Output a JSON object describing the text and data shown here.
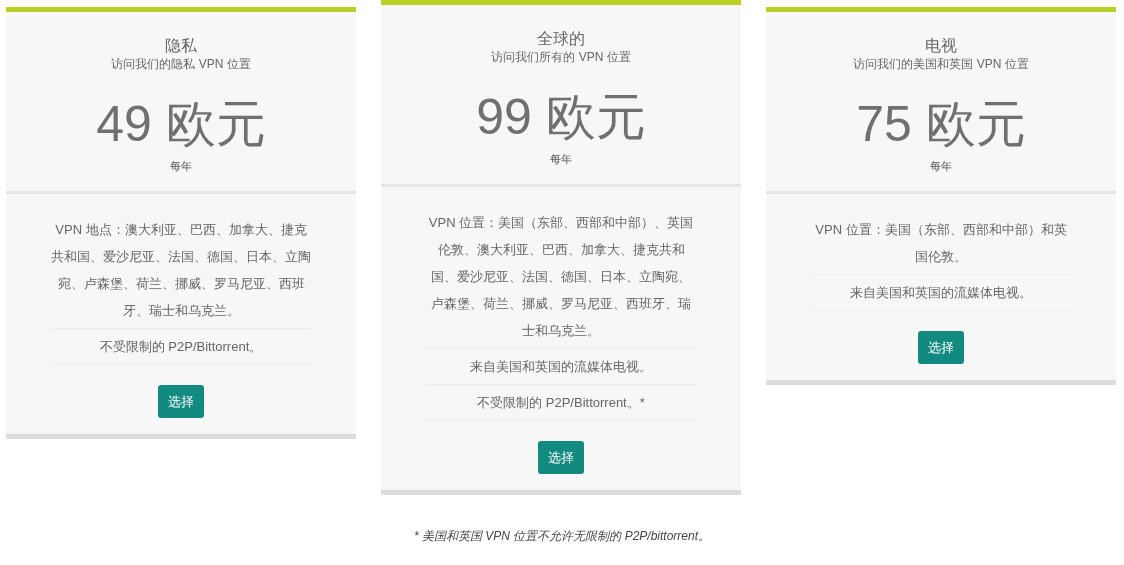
{
  "plans": [
    {
      "title": "隐私",
      "subtitle": "访问我们的隐私 VPN 位置",
      "price": "49 欧元",
      "period": "每年",
      "featured": false,
      "features": [
        "VPN 地点：澳大利亚、巴西、加拿大、捷克共和国、爱沙尼亚、法国、德国、日本、立陶宛、卢森堡、荷兰、挪威、罗马尼亚、西班牙、瑞士和乌克兰。",
        "不受限制的 P2P/Bittorrent。"
      ],
      "button": "选择"
    },
    {
      "title": "全球的",
      "subtitle": "访问我们所有的 VPN 位置",
      "price": "99 欧元",
      "period": "每年",
      "featured": true,
      "features": [
        "VPN 位置：美国（东部、西部和中部）、英国伦敦、澳大利亚、巴西、加拿大、捷克共和国、爱沙尼亚、法国、德国、日本、立陶宛、卢森堡、荷兰、挪威、罗马尼亚、西班牙、瑞士和乌克兰。",
        "来自美国和英国的流媒体电视。",
        "不受限制的 P2P/Bittorrent。*"
      ],
      "button": "选择"
    },
    {
      "title": "电视",
      "subtitle": "访问我们的美国和英国 VPN 位置",
      "price": "75 欧元",
      "period": "每年",
      "featured": false,
      "features": [
        "VPN 位置：美国（东部、西部和中部）和英国伦敦。",
        "来自美国和英国的流媒体电视。"
      ],
      "button": "选择"
    }
  ],
  "footnote": "* 美国和英国 VPN 位置不允许无限制的 P2P/bittorrent。"
}
